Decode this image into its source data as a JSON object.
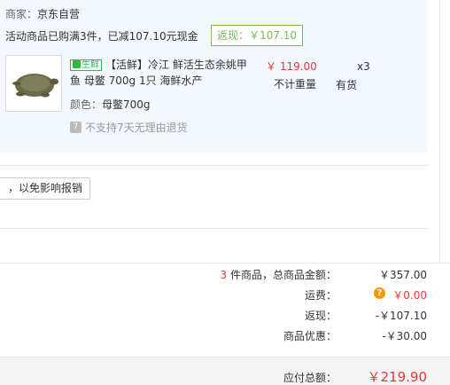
{
  "shop": {
    "merchant_label": "商家：",
    "merchant_name": "京东自营",
    "promo_text": "活动商品已购满3件，已减107.10元现金",
    "rebate_label": "返现：￥107.10"
  },
  "item": {
    "tag": "鲜",
    "tag_prefix": "生",
    "title": "【活鲜】冷江 鲜活生态余姚甲鱼 母鳖 700g 1只 海鲜水产",
    "color_label": "颜色：",
    "color_value": "母鳖700g",
    "no_return": "不支持7天无理由退货",
    "no_return_icon": "7",
    "price": "￥ 119.00",
    "weight": "不计重量",
    "qty": "x3",
    "stock": "有货"
  },
  "invoice_tip": "，以免影响报销",
  "summary": {
    "count": "3",
    "count_suffix": " 件商品，总商品金额：",
    "goods_total": "￥357.00",
    "freight_label": "运费：",
    "freight_value": "￥0.00",
    "freight_icon": "?",
    "cashback_label": "返现：",
    "cashback_value": "-￥107.10",
    "discount_label": "商品优惠：",
    "discount_value": "-￥30.00",
    "payable_label": "应付总额：",
    "payable_value": "￥219.90"
  },
  "colors": {
    "accent_red": "#e4393c",
    "fresh_green": "#2fb94a",
    "rebate_green": "#7abd54",
    "panel_bg": "#f3f8fe"
  }
}
